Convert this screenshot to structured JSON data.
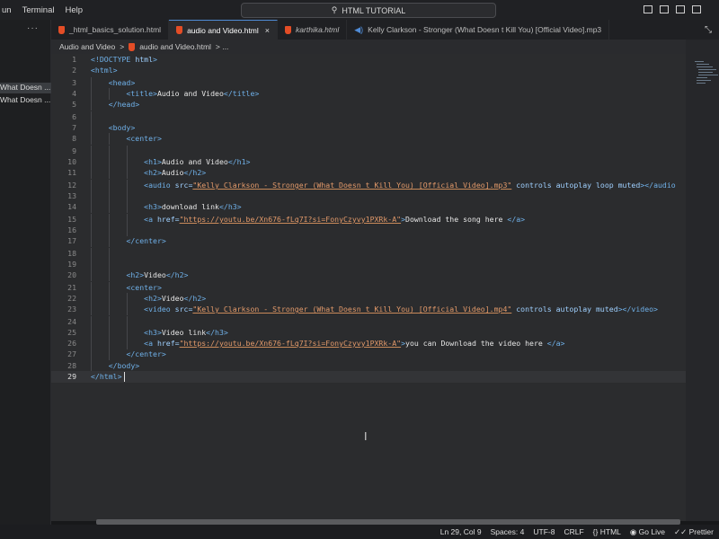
{
  "menu": [
    "Run",
    "Terminal",
    "Help"
  ],
  "menu_display": [
    "un",
    "Terminal",
    "Help"
  ],
  "search": {
    "label": "HTML TUTORIAL",
    "icon": "search-icon"
  },
  "sidebar": {
    "more": "···",
    "files": [
      "What Doesn ...",
      "What Doesn ..."
    ]
  },
  "tabs": [
    {
      "label": "_html_basics_solution.html",
      "icon": "html-file-icon",
      "active": false,
      "italic": false
    },
    {
      "label": "audio and Video.html",
      "icon": "html-file-icon",
      "active": true,
      "italic": false,
      "close": "×"
    },
    {
      "label": "karthika.html",
      "icon": "html-file-icon",
      "active": false,
      "italic": true
    },
    {
      "label": "Kelly Clarkson - Stronger (What Doesn t Kill You) [Official Video].mp3",
      "icon": "speaker-icon",
      "active": false,
      "italic": false
    }
  ],
  "breadcrumb": {
    "folder": "Audio and Video",
    "sep": ">",
    "file": "audio and Video.html",
    "tail": "> ..."
  },
  "code": {
    "line_numbers": [
      "1",
      "2",
      "3",
      "4",
      "5",
      "6",
      "7",
      "8",
      "9",
      "10",
      "11",
      "12",
      "13",
      "14",
      "15",
      "16",
      "17",
      "18",
      "19",
      "20",
      "21",
      "22",
      "23",
      "24",
      "25",
      "26",
      "27",
      "28",
      "29"
    ],
    "current_line": 29
  },
  "status": {
    "position": "Ln 29, Col 9",
    "spaces": "Spaces: 4",
    "encoding": "UTF-8",
    "eol": "CRLF",
    "language": "HTML",
    "live": "Go Live",
    "prettier": "Prettier"
  },
  "colors": {
    "tag": "#6fb0e8",
    "string": "#e39a6a",
    "text": "#e6e6e6",
    "html_icon": "#e44d26",
    "accent": "#4f8bd6"
  }
}
